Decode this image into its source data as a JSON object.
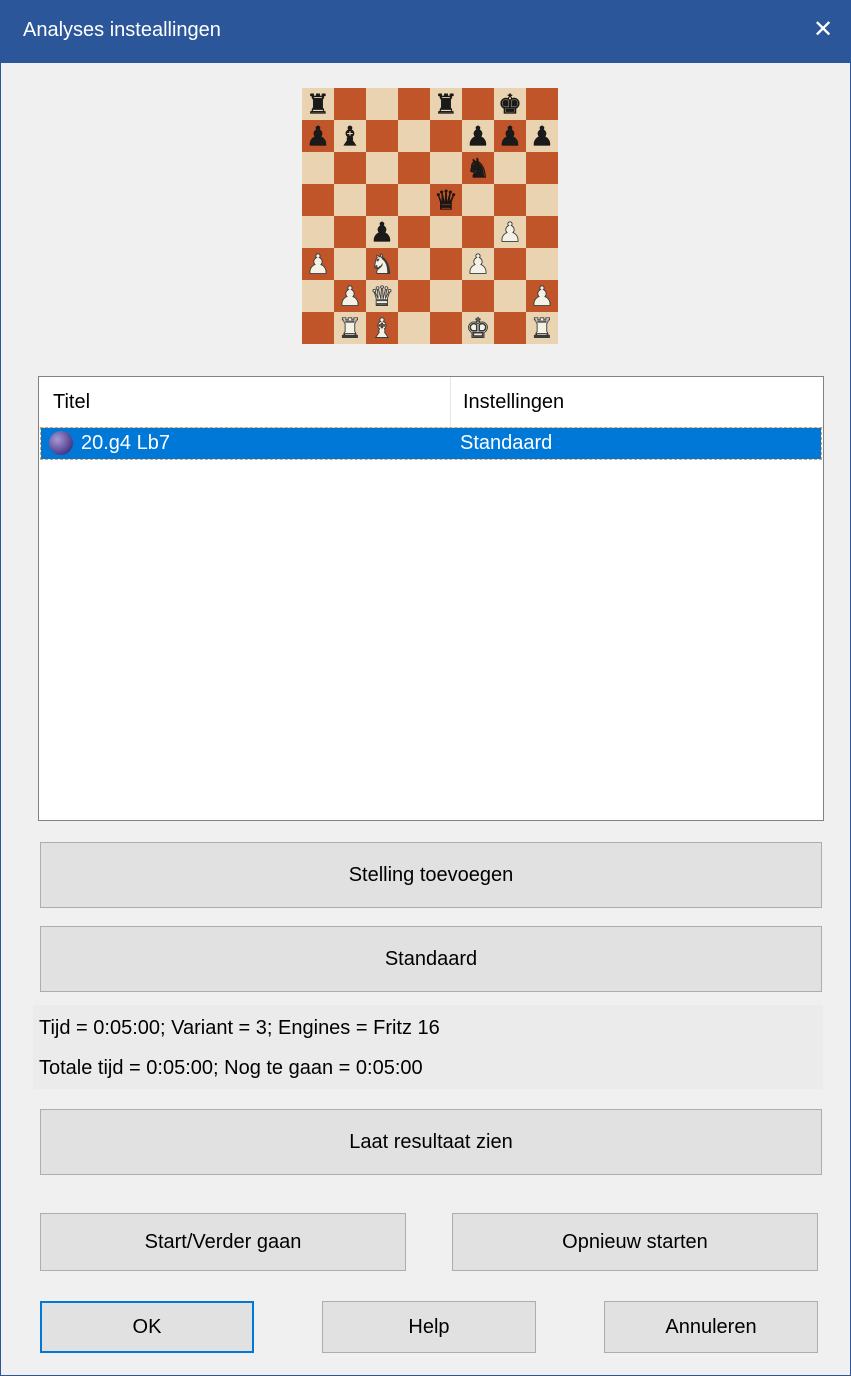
{
  "window": {
    "title": "Analyses insteallingen",
    "close_glyph": "✕"
  },
  "board": {
    "light_color": "#e9d3b0",
    "dark_color": "#c0552a",
    "ranks": [
      "r...r.k.",
      "pb...ppp",
      ".....n..",
      "....q...",
      "..p...P.",
      "P.N..P..",
      ".PQ....P",
      ".RB..K.R"
    ]
  },
  "list": {
    "columns": [
      "Titel",
      "Instellingen"
    ],
    "rows": [
      {
        "icon": "position-ball-icon",
        "title": "20.g4 Lb7",
        "settings": "Standaard"
      }
    ]
  },
  "buttons": {
    "add_position": "Stelling toevoegen",
    "standard": "Standaard",
    "show_result": "Laat resultaat zien",
    "start_continue": "Start/Verder gaan",
    "restart": "Opnieuw starten",
    "ok": "OK",
    "help": "Help",
    "cancel": "Annuleren"
  },
  "info": {
    "line1": "Tijd = 0:05:00; Variant = 3; Engines = Fritz 16",
    "line2": "Totale tijd = 0:05:00; Nog te gaan = 0:05:00"
  }
}
